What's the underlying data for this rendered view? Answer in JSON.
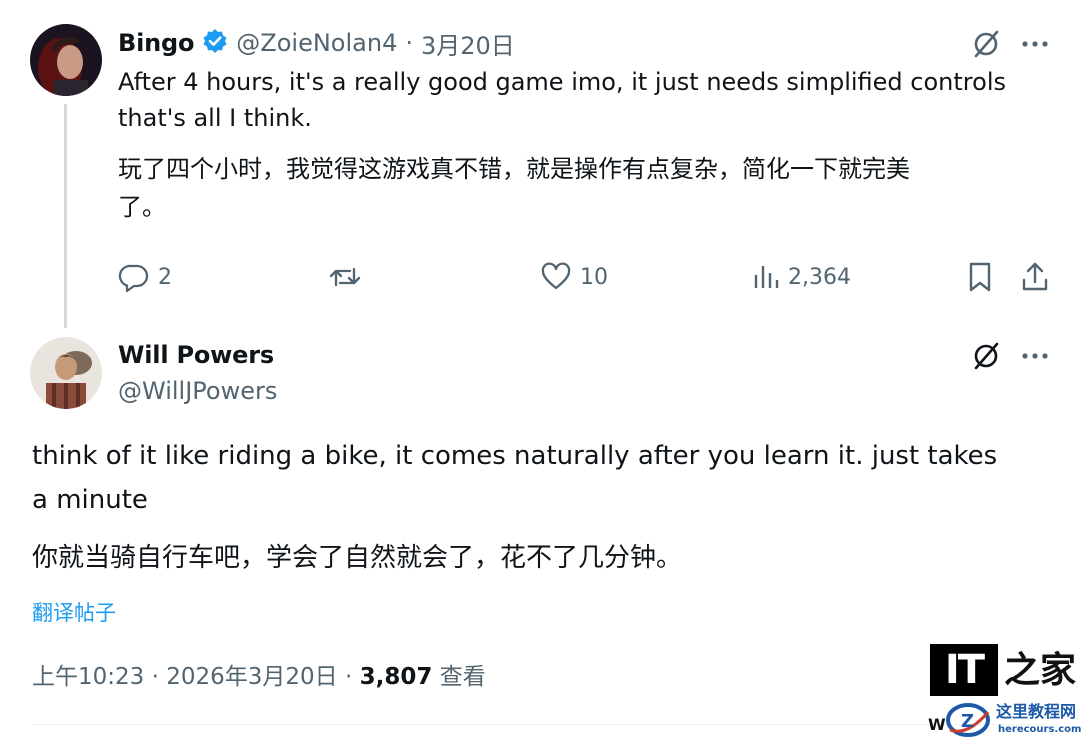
{
  "reply": {
    "name": "Bingo",
    "handle": "@ZoieNolan4",
    "separator": "·",
    "date": "3月20日",
    "text_en_line1": "After 4 hours, it's a really good game imo, it just needs simplified controls",
    "text_en_line2": "that's all I think.",
    "text_zh_line1": "玩了四个小时，我觉得这游戏真不错，就是操作有点复杂，简化一下就完美",
    "text_zh_line2": "了。",
    "replies": "2",
    "likes": "10",
    "views": "2,364"
  },
  "main_post": {
    "name": "Will Powers",
    "handle": "@WillJPowers",
    "text_en_line1": "think of it like riding a bike, it comes naturally after you learn it. just takes",
    "text_en_line2": "a minute",
    "text_zh": "你就当骑自行车吧，学会了自然就会了，花不了几分钟。",
    "translate_label": "翻译帖子",
    "time": "上午10:23",
    "sep": "·",
    "date": "2026年3月20日",
    "views_count": "3,807",
    "views_label": "查看"
  },
  "watermark": {
    "it": "IT",
    "zh": "之家",
    "site_name": "这里教程网",
    "site_url": "herecours.com"
  },
  "colors": {
    "accent": "#1d9bf0",
    "secondary_text": "#536471",
    "thread_line": "#cfd9de"
  }
}
